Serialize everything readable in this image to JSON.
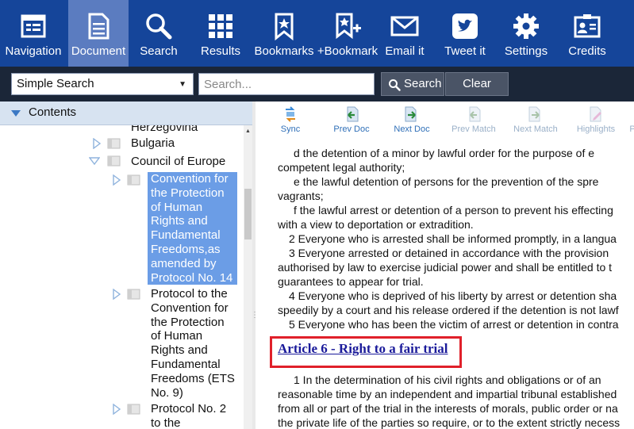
{
  "toolbar": {
    "buttons": [
      {
        "label": "Navigation",
        "icon": "navigation-icon"
      },
      {
        "label": "Document",
        "icon": "document-icon"
      },
      {
        "label": "Search",
        "icon": "search-icon"
      },
      {
        "label": "Results",
        "icon": "results-grid-icon"
      },
      {
        "label": "Bookmarks",
        "icon": "bookmarks-icon"
      },
      {
        "label": "+Bookmark",
        "icon": "add-bookmark-icon"
      },
      {
        "label": "Email it",
        "icon": "email-icon"
      },
      {
        "label": "Tweet it",
        "icon": "twitter-icon"
      },
      {
        "label": "Settings",
        "icon": "gear-icon"
      },
      {
        "label": "Credits",
        "icon": "credits-icon"
      }
    ],
    "active": "Document",
    "colors": {
      "bar": "#15459a",
      "active": "#5b7cc0"
    }
  },
  "search": {
    "mode": "Simple Search",
    "placeholder": "Search...",
    "search_label": "Search",
    "clear_label": "Clear"
  },
  "contents": {
    "header": "Contents",
    "nodes": {
      "herzegovina": "Herzegovina",
      "bulgaria": "Bulgaria",
      "council": "Council of Europe",
      "convention": [
        "Convention for",
        "the Protection",
        "of Human",
        "Rights and",
        "Fundamental",
        "Freedoms,as",
        "amended by",
        "Protocol No. 14"
      ],
      "protocol": [
        "Protocol to the",
        "Convention for",
        "the Protection",
        "of Human",
        "Rights and",
        "Fundamental",
        "Freedoms (ETS",
        "No. 9)"
      ],
      "protocol2": [
        "Protocol No. 2",
        "to the"
      ]
    },
    "selection_color": "#6b9de6"
  },
  "doctools": [
    {
      "label": "Sync",
      "icon": "sync-icon",
      "enabled": true
    },
    {
      "label": "Prev Doc",
      "icon": "prev-doc-icon",
      "enabled": true
    },
    {
      "label": "Next Doc",
      "icon": "next-doc-icon",
      "enabled": true
    },
    {
      "label": "Prev Match",
      "icon": "prev-match-icon",
      "enabled": false
    },
    {
      "label": "Next Match",
      "icon": "next-match-icon",
      "enabled": false
    },
    {
      "label": "Highlights",
      "icon": "highlights-icon",
      "enabled": false
    },
    {
      "label": "P",
      "icon": "print-icon",
      "enabled": false
    }
  ],
  "document": {
    "lines": [
      "d   the detention of a minor by lawful order for the purpose of e",
      "competent legal authority;",
      "e   the lawful detention of persons for the prevention of the spre",
      "vagrants;",
      "f   the lawful arrest or detention of a person to prevent his effecting",
      "with a view to deportation or extradition.",
      "2   Everyone who is arrested shall be informed promptly, in a langua",
      "3   Everyone arrested or detained in accordance with the provision",
      "authorised by law to exercise judicial power and shall be entitled to t",
      "guarantees to appear for trial.",
      "4   Everyone who is deprived of his liberty by arrest or detention sha",
      "speedily by a court and his release ordered if the detention is not lawf",
      "5   Everyone who has been the victim of arrest or detention in contra"
    ],
    "article_title": "Article 6 - Right to a fair trial",
    "after_lines": [
      "1   In the determination of his civil rights and obligations or of an",
      "reasonable time by an independent and impartial tribunal established",
      "from all or part of the trial in the interests of morals, public order or na",
      "the private life of the parties so require, or to the extent strictly necess"
    ],
    "highlight_color": "#e0202a"
  }
}
